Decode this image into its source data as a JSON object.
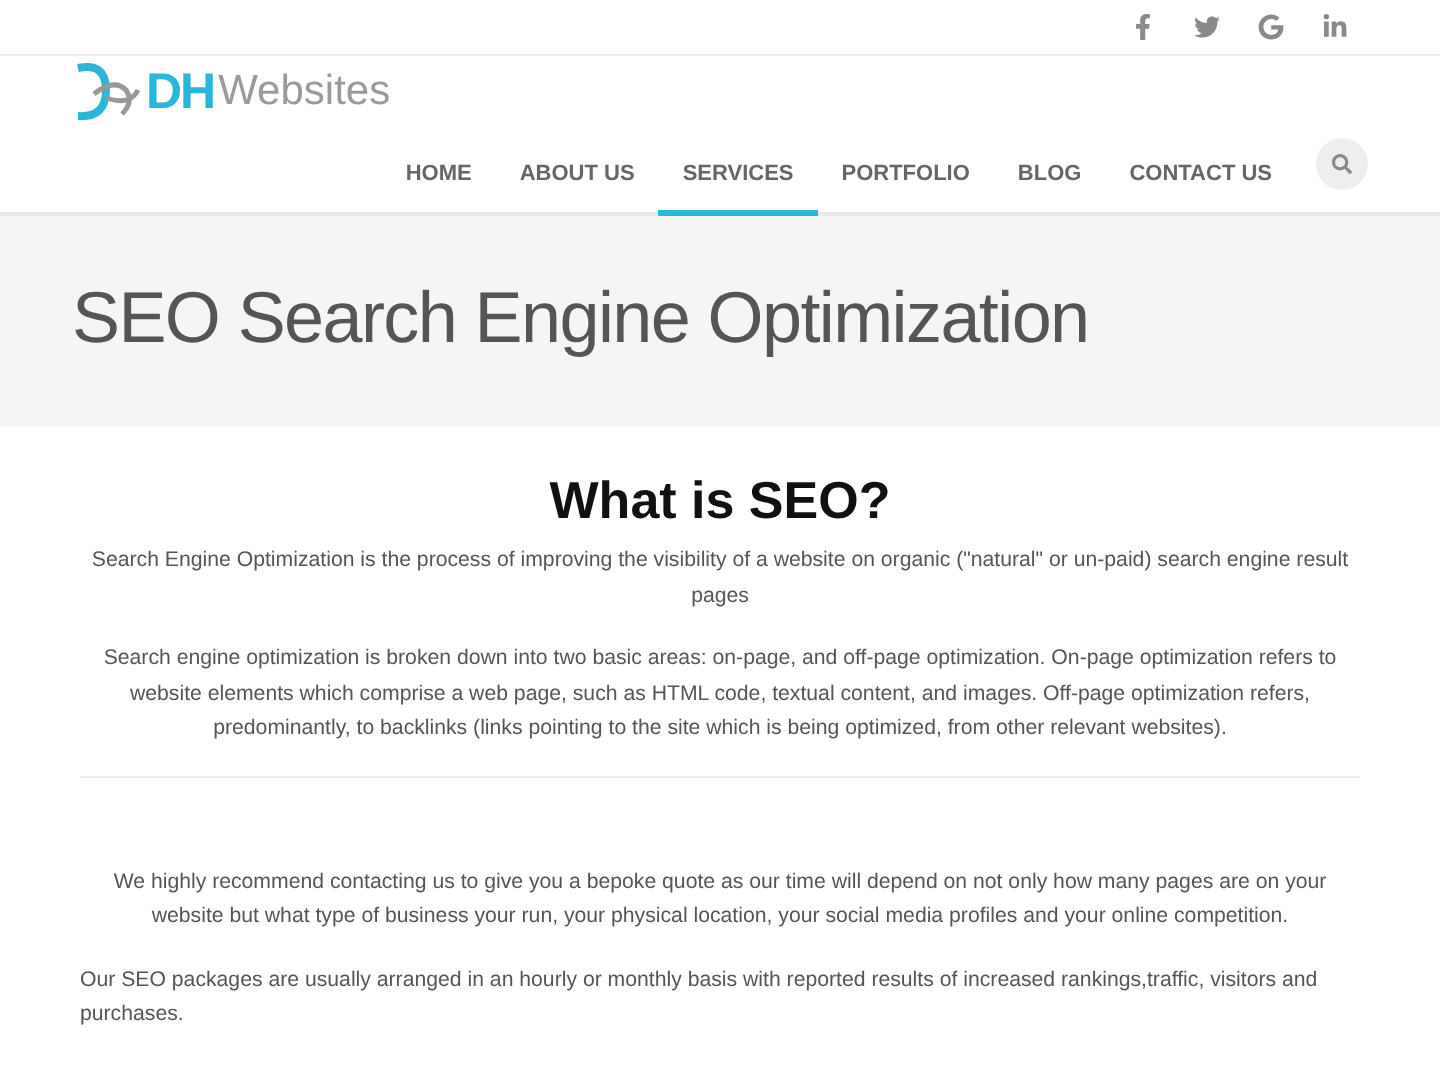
{
  "social_links": [
    {
      "kind": "facebook"
    },
    {
      "kind": "twitter"
    },
    {
      "kind": "google"
    },
    {
      "kind": "linkedin"
    }
  ],
  "logo": {
    "mark": "DH",
    "name": "Websites"
  },
  "nav": [
    {
      "label": "HOME",
      "selected": false
    },
    {
      "label": "ABOUT US",
      "selected": false
    },
    {
      "label": "SERVICES",
      "selected": true
    },
    {
      "label": "PORTFOLIO",
      "selected": false
    },
    {
      "label": "BLOG",
      "selected": false
    },
    {
      "label": "CONTACT US",
      "selected": false
    }
  ],
  "page_title": "SEO Search Engine Optimization",
  "intro": {
    "heading": "What is SEO?",
    "paragraphs": [
      "Search Engine Optimization is the process of improving the visibility of a website on organic (\"natural\" or un-paid) search engine result pages",
      "Search engine optimization is broken down into two basic areas: on-page, and off-page optimization. On-page optimization refers to website elements which comprise a web page, such as HTML code, textual content, and images. Off-page optimization refers, predominantly, to backlinks (links pointing to the site which is being optimized, from other relevant websites)."
    ]
  },
  "details": [
    {
      "kind": "centered",
      "text": "We highly recommend contacting us to give you a bepoke quote as our time will depend on not only how many pages are on your website but what type of business your run, your physical location, your social media profiles and your online competition."
    },
    {
      "kind": "left",
      "text": "Our SEO packages are usually arranged in an hourly or monthly basis with reported results of increased rankings,traffic, visitors and purchases."
    }
  ]
}
